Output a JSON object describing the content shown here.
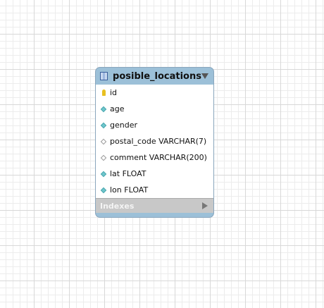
{
  "table": {
    "name": "posible_locations",
    "columns": [
      {
        "label": "id",
        "icon": "primary-key-icon"
      },
      {
        "label": "age",
        "icon": "filled-diamond-icon"
      },
      {
        "label": "gender",
        "icon": "filled-diamond-icon"
      },
      {
        "label": "postal_code VARCHAR(7)",
        "icon": "empty-diamond-icon"
      },
      {
        "label": "comment VARCHAR(200)",
        "icon": "empty-diamond-icon"
      },
      {
        "label": "lat FLOAT",
        "icon": "filled-diamond-icon"
      },
      {
        "label": "lon FLOAT",
        "icon": "filled-diamond-icon"
      }
    ],
    "indexes_label": "Indexes",
    "header_color": "#9cc0d8"
  }
}
